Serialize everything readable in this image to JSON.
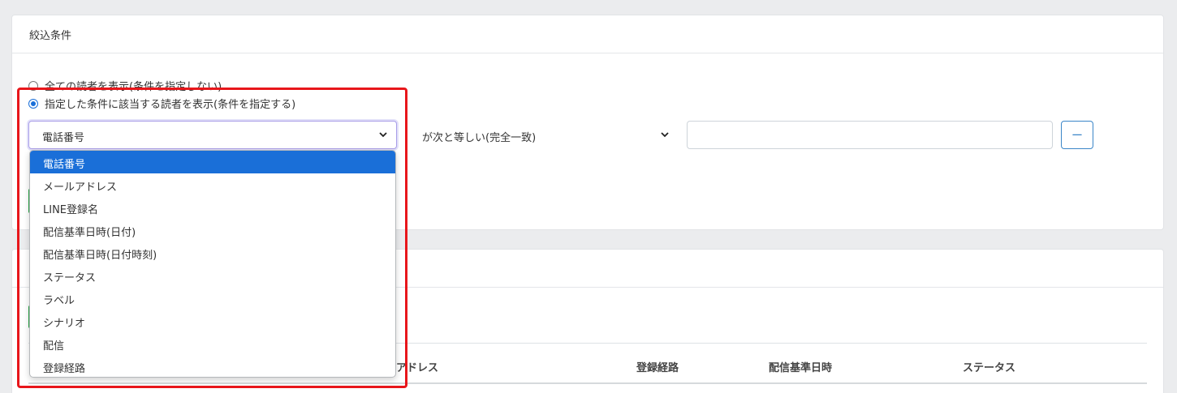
{
  "filter": {
    "title": "絞込条件",
    "radio_all_label": "全ての読者を表示(条件を指定しない)",
    "radio_specified_label": "指定した条件に該当する読者を表示(条件を指定する)",
    "field_select_value": "電話番号",
    "operator_select_value": "が次と等しい(完全一致)",
    "value_input": "",
    "remove_button_label": "ー"
  },
  "dropdown": {
    "options": [
      "電話番号",
      "メールアドレス",
      "LINE登録名",
      "配信基準日時(日付)",
      "配信基準日時(日付時刻)",
      "ステータス",
      "ラベル",
      "シナリオ",
      "配信",
      "登録経路"
    ],
    "selected_index": 0
  },
  "table": {
    "headers": [
      "アドレス",
      "登録経路",
      "配信基準日時",
      "ステータス"
    ]
  },
  "colors": {
    "accent": "#1a6fd8",
    "highlight": "#e8161b",
    "success": "#28a745"
  }
}
